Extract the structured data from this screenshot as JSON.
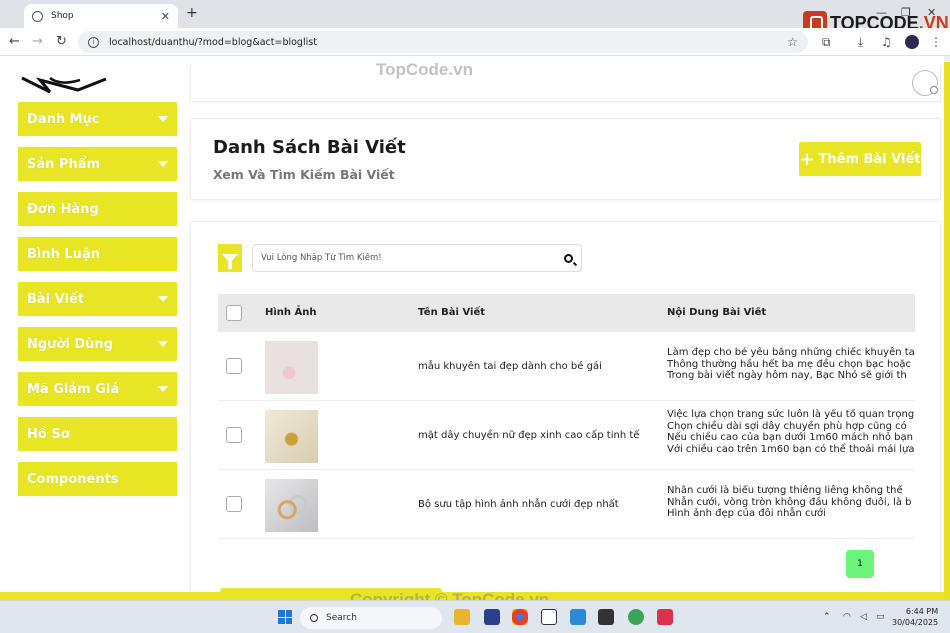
{
  "browser": {
    "tab_title": "Shop",
    "tab_close": "✕",
    "new_tab": "+",
    "url": "localhost/duanthu/?mod=blog&act=bloglist",
    "minimize": "—",
    "restore": "❐",
    "close": "✕"
  },
  "watermarks": {
    "logo_text_1": "TOPCODE",
    "logo_text_2": ".VN",
    "top": "TopCode.vn",
    "bottom": "Copyright © TopCode.vn"
  },
  "sidebar": {
    "items": [
      {
        "label": "Danh Mục",
        "has_caret": true
      },
      {
        "label": "Sản Phẩm",
        "has_caret": true
      },
      {
        "label": "Đơn Hàng",
        "has_caret": false
      },
      {
        "label": "Bình Luận",
        "has_caret": false
      },
      {
        "label": "Bài Viết",
        "has_caret": true
      },
      {
        "label": "Người Dùng",
        "has_caret": true
      },
      {
        "label": "Mã Giảm Giá",
        "has_caret": true
      },
      {
        "label": "Hồ Sơ",
        "has_caret": false
      },
      {
        "label": "Components",
        "has_caret": false
      }
    ]
  },
  "header": {
    "title": "Danh Sách Bài Viết",
    "subtitle": "Xem Và Tìm Kiếm Bài Viết",
    "add_button": "Thêm Bài Viết"
  },
  "search": {
    "placeholder": "Vui Lòng Nhập Từ Tìm Kiếm!"
  },
  "table": {
    "columns": [
      "Hình Ảnh",
      "Tên Bài Viết",
      "Nội Dung Bài Viết"
    ],
    "rows": [
      {
        "title": "mẫu khuyên tai đẹp dành cho bé gái",
        "content": [
          "Làm đẹp cho bé yêu bằng những chiếc khuyên tai",
          "Thông thường hầu hết ba mẹ đều chọn bạc hoặc",
          "Trong bài viết ngày hôm nay, Bạc Nhỏ sẽ giới th"
        ]
      },
      {
        "title": "mặt dây chuyền nữ đẹp xinh cao cấp tinh tế",
        "content": [
          "Việc lựa chọn trang sức luôn là yếu tố quan trọng",
          "Chọn chiều dài sợi dây chuyền phù hợp cũng có",
          "Nếu chiều cao của bạn dưới 1m60 mách nhỏ bạn",
          "Với chiều cao trên 1m60 bạn có thể thoải mái lựa"
        ]
      },
      {
        "title": "Bộ sưu tập hình ảnh nhẫn cưới đẹp nhất",
        "content": [
          "Nhẫn cưới là biểu tượng thiêng liêng không thể",
          "Nhẫn cưới, vòng tròn không đầu không đuôi, là b",
          "Hình ảnh đẹp của đôi nhẫn cưới"
        ]
      }
    ]
  },
  "pagination": {
    "current": "1"
  },
  "taskbar": {
    "search_label": "Search",
    "time": "6:44 PM",
    "date": "30/04/2025"
  },
  "colors": {
    "accent": "#e8e524",
    "pagination": "#6cf37a"
  }
}
